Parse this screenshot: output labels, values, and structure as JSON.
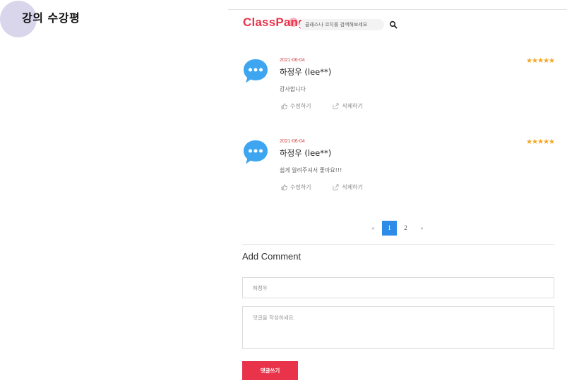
{
  "page": {
    "heading": "강의 수강평"
  },
  "header": {
    "logo": "ClassPang",
    "search_placeholder": "클래스나 코치를 검색해보세요",
    "search_icon": "search-icon"
  },
  "reviews": [
    {
      "date": "2021-06-04",
      "name": "하정우 (lee**)",
      "comment": "감사합니다",
      "stars": "★★★★★",
      "rating": 5,
      "edit_label": "수정하기",
      "delete_label": "삭제하기"
    },
    {
      "date": "2021-06-04",
      "name": "하정우 (lee**)",
      "comment": "쉽게 알려주셔서 좋아요!!!",
      "stars": "★★★★★",
      "rating": 5,
      "edit_label": "수정하기",
      "delete_label": "삭제하기"
    }
  ],
  "pagination": {
    "prev": "«",
    "pages": [
      "1",
      "2"
    ],
    "current": "1",
    "next": "»"
  },
  "comment_form": {
    "title": "Add Comment",
    "name_value": "하정우",
    "comment_placeholder": "댓글을 작성하세요.",
    "submit_label": "댓글쓰기"
  },
  "colors": {
    "brand": "#e8334a",
    "pagination_active": "#2d8ce8",
    "star": "#f5a623",
    "date": "#d64545",
    "avatar": "#3ea6f0",
    "heading_circle": "#d9d6ec"
  }
}
